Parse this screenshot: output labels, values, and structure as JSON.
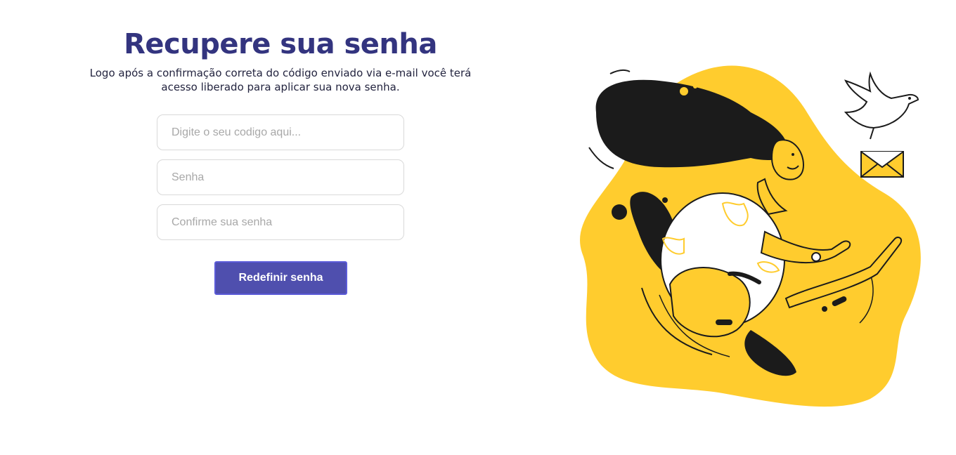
{
  "page": {
    "title": "Recupere sua senha",
    "subtitle": "Logo após a confirmação correta do código enviado via e-mail você terá acesso liberado para aplicar sua nova senha."
  },
  "form": {
    "code_placeholder": "Digite o seu codigo aqui...",
    "password_placeholder": "Senha",
    "confirm_placeholder": "Confirme sua senha",
    "submit_label": "Redefinir senha"
  },
  "colors": {
    "title": "#33347f",
    "button": "#4f4fae",
    "illustration_bg": "#ffcc2e",
    "illustration_ink": "#1b1b1b"
  },
  "illustration": {
    "icons": [
      "woman-illustration",
      "dove-icon",
      "envelope-icon"
    ]
  }
}
